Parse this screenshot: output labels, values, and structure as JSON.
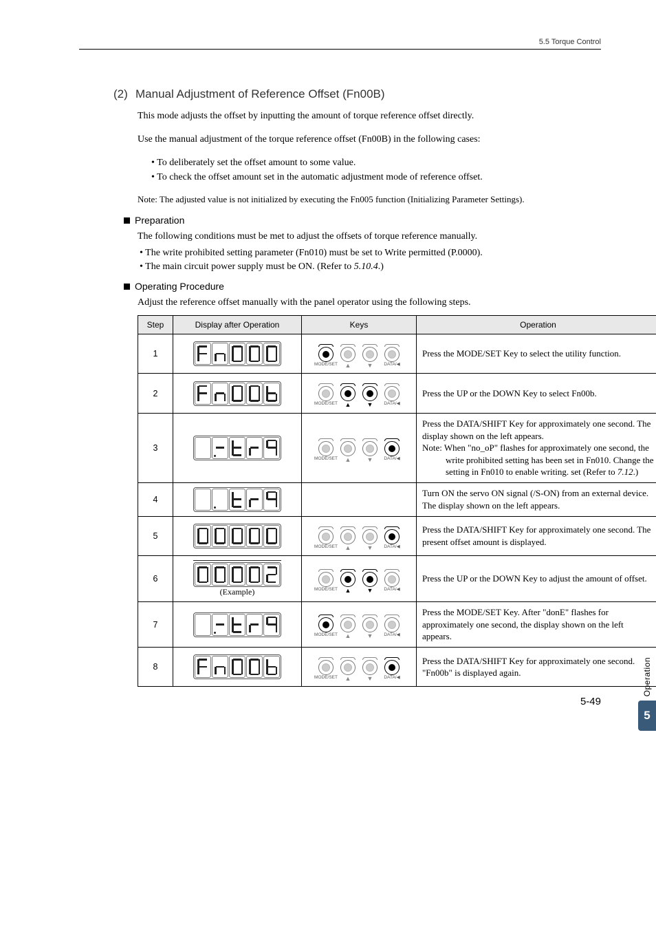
{
  "header": {
    "section": "5.5  Torque Control"
  },
  "heading2": {
    "num": "(2)",
    "title": "Manual Adjustment of Reference Offset (Fn00B)"
  },
  "p1": "This mode adjusts the offset by inputting the amount of torque reference offset directly.",
  "p2": "Use the manual adjustment of the torque reference offset (Fn00B) in the following cases:",
  "bullets": [
    "• To deliberately set the offset amount to some value.",
    "• To check the offset amount set in the automatic adjustment mode of reference offset."
  ],
  "note": "Note: The adjusted value is not initialized by executing the Fn005 function (Initializing Parameter Settings).",
  "prep": {
    "title": "Preparation",
    "lead": "The following conditions must be met to adjust the offsets of torque reference manually.",
    "items": [
      "• The write prohibited setting parameter (Fn010) must be set to Write permitted (P.0000).",
      "• The main circuit power supply must be ON. (Refer to "
    ],
    "ref": "5.10.4",
    "ref_after": ".)"
  },
  "proc": {
    "title": "Operating Procedure",
    "lead": "Adjust the reference offset manually with the panel operator using the following steps."
  },
  "table": {
    "headers": {
      "step": "Step",
      "display": "Display after Operation",
      "keys": "Keys",
      "operation": "Operation"
    },
    "rows": [
      {
        "step": "1",
        "display": "Fn000",
        "keys_active": [
          "mode"
        ],
        "operation": "Press the MODE/SET Key to select the utility function."
      },
      {
        "step": "2",
        "display": "Fn00b",
        "keys_active": [
          "up",
          "down"
        ],
        "operation": "Press the UP or the DOWN Key to select Fn00b."
      },
      {
        "step": "3",
        "display": "-.trq",
        "keys_active": [
          "data"
        ],
        "operation_main": "Press the DATA/SHIFT Key for approximately one second. The display shown on the left appears.",
        "operation_noteA": "Note: When \"no_oP\" flashes for approximately one second, the write prohibited setting has been set in Fn010. Change the setting in Fn010 to enable writing. set (Refer to ",
        "operation_ref": "7.12",
        "operation_noteB": ".)"
      },
      {
        "step": "4",
        "display": " .trq",
        "keys_active": [],
        "operation": "Turn ON the servo ON signal (/S-ON) from an external device. The display shown on the left appears."
      },
      {
        "step": "5",
        "display": "00000",
        "keys_active": [
          "data"
        ],
        "operation": "Press the DATA/SHIFT Key for approximately one second. The present offset amount is displayed."
      },
      {
        "step": "6",
        "display": "00002",
        "keys_active": [
          "up",
          "down"
        ],
        "example": "(Example)",
        "operation": "Press the UP or the DOWN Key to adjust the amount of offset."
      },
      {
        "step": "7",
        "display": "-.trq",
        "keys_active": [
          "mode"
        ],
        "operation": "Press the MODE/SET Key. After \"donE\" flashes for approximately one second, the display shown on the left appears."
      },
      {
        "step": "8",
        "display": "Fn00b",
        "keys_active": [
          "data"
        ],
        "operation": "Press the DATA/SHIFT Key for approximately one second. \"Fn00b\" is displayed again."
      }
    ]
  },
  "keypad": {
    "labels": {
      "mode": "MODE/SET",
      "up": "▲",
      "down": "▼",
      "data": "DATA/◀"
    }
  },
  "sideTab": {
    "label": "Operation",
    "num": "5"
  },
  "pageNum": "5-49"
}
